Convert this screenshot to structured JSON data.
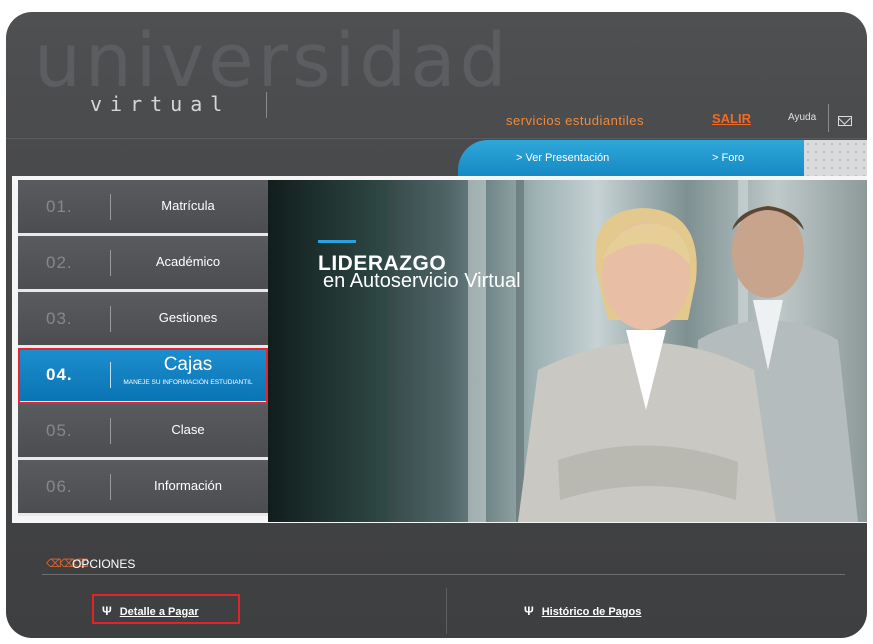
{
  "header": {
    "logo_big": "universidad",
    "logo_small": "virtual",
    "services": "servicios estudiantiles",
    "logout": "SALIR",
    "help": "Ayuda",
    "mail_icon": "envelope-icon"
  },
  "tabs": [
    {
      "label": "> Ver Presentación"
    },
    {
      "label": "> Foro"
    }
  ],
  "nav": {
    "items": [
      {
        "num": "01.",
        "label": "Matrícula"
      },
      {
        "num": "02.",
        "label": "Académico"
      },
      {
        "num": "03.",
        "label": "Gestiones"
      },
      {
        "num": "04.",
        "label": "Cajas",
        "sub": "MANEJE SU INFORMACIÓN ESTUDIANTIL"
      },
      {
        "num": "05.",
        "label": "Clase"
      },
      {
        "num": "06.",
        "label": "Información"
      }
    ]
  },
  "hero": {
    "title": "LIDERAZGO",
    "subtitle": "en Autoservicio Virtual"
  },
  "options": {
    "title": "OPCIONES",
    "links": [
      {
        "label": "Detalle a Pagar"
      },
      {
        "label": "Histórico de Pagos"
      }
    ]
  },
  "colors": {
    "accent_blue": "#1689c4",
    "accent_orange": "#f06a2a",
    "highlight_red": "#e4272f"
  }
}
